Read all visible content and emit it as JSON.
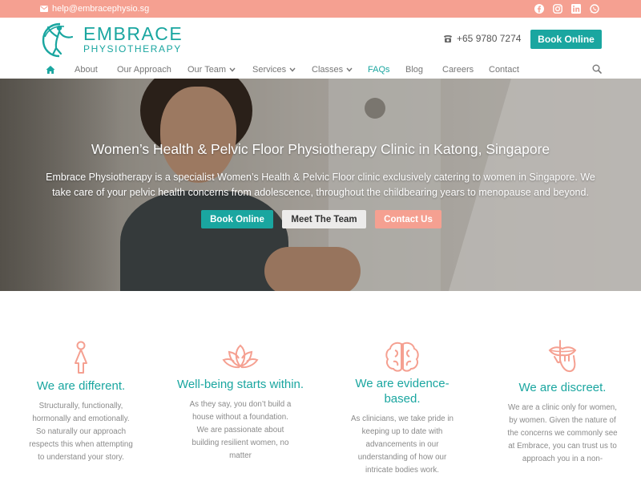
{
  "topbar": {
    "email": "help@embracephysio.sg",
    "socials": [
      "facebook-icon",
      "instagram-icon",
      "linkedin-icon",
      "whatsapp-icon"
    ]
  },
  "brand": {
    "line1": "EMBRACE",
    "line2": "PHYSIOTHERAPY",
    "accent": "#1aa6a0",
    "coral": "#f5a091"
  },
  "header": {
    "phone": "+65 9780 7274",
    "book_label": "Book Online"
  },
  "nav": {
    "items": [
      {
        "label": "About"
      },
      {
        "label": "Our Approach"
      },
      {
        "label": "Our Team"
      },
      {
        "label": "Services"
      },
      {
        "label": "Classes"
      },
      {
        "label": "FAQs"
      },
      {
        "label": "Blog"
      },
      {
        "label": "Careers"
      },
      {
        "label": "Contact"
      }
    ]
  },
  "hero": {
    "title": "Women’s Health & Pelvic Floor Physiotherapy Clinic in Katong, Singapore",
    "description": "Embrace Physiotherapy is a specialist Women’s Health & Pelvic Floor clinic exclusively catering to women in Singapore. We take care of your pelvic health concerns from adolescence, throughout the childbearing years to menopause and beyond.",
    "buttons": [
      "Book Online",
      "Meet The Team",
      "Contact Us"
    ]
  },
  "features": [
    {
      "icon": "woman-icon",
      "title": "We are different.",
      "text": "Structurally, functionally, hormonally and emotionally. So naturally our approach respects this when attempting to understand your story."
    },
    {
      "icon": "lotus-icon",
      "title": "Well-being starts within.",
      "text": "As they say, you don’t build a house without a foundation. We are passionate about building resilient women, no matter"
    },
    {
      "icon": "brain-icon",
      "title": "We are evidence-based.",
      "text": "As clinicians, we take pride in keeping up to date with advancements in our understanding of how our intricate bodies work."
    },
    {
      "icon": "shush-icon",
      "title": "We are discreet.",
      "text": "We are a clinic only for women, by women. Given the nature of the concerns we commonly see at Embrace, you can trust us to approach you in a non-"
    }
  ]
}
